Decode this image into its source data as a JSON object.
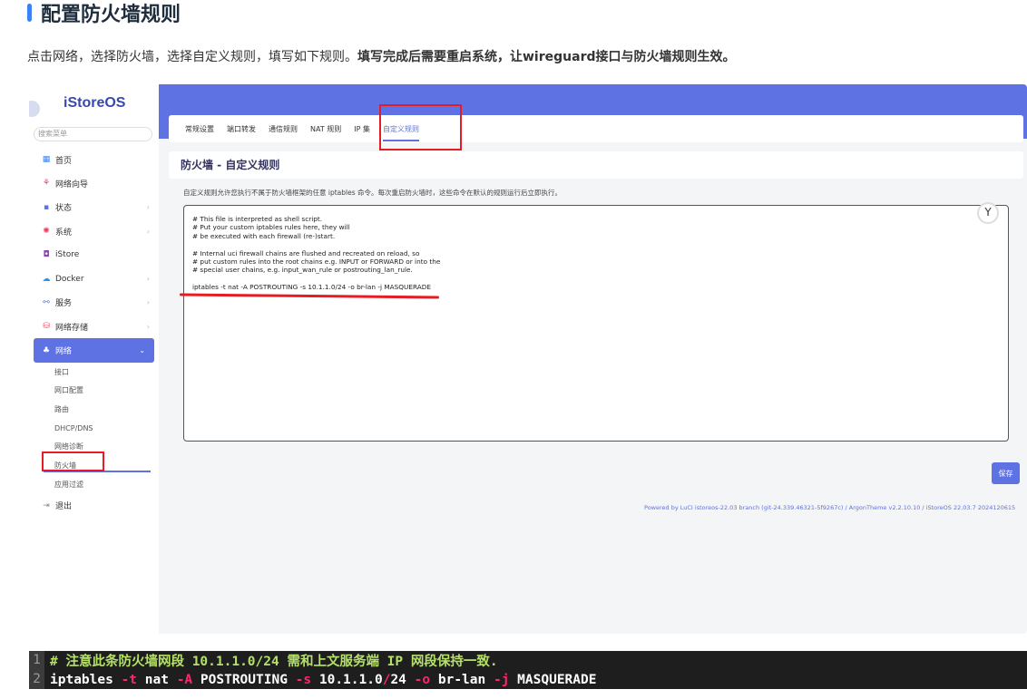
{
  "article": {
    "title": "配置防火墙规则",
    "desc_plain": "点击网络，选择防火墙，选择自定义规则，填写如下规则。",
    "desc_bold": "填写完成后需要重启系统，让wireguard接口与防火墙规则生效。"
  },
  "sidebar": {
    "logo": "iStoreOS",
    "search_placeholder": "搜索菜单",
    "items": [
      {
        "label": "首页",
        "icon": "home-icon",
        "glyph": "▦",
        "color": "#3b82f6"
      },
      {
        "label": "网络向导",
        "icon": "wizard-icon",
        "glyph": "⚘",
        "color": "#f5365c"
      },
      {
        "label": "状态",
        "icon": "status-icon",
        "glyph": "▪",
        "color": "#5e72e4",
        "chevron": "›"
      },
      {
        "label": "系统",
        "icon": "system-icon",
        "glyph": "✺",
        "color": "#f5365c",
        "chevron": "›"
      },
      {
        "label": "iStore",
        "icon": "store-icon",
        "glyph": "◘",
        "color": "#8e44ad"
      },
      {
        "label": "Docker",
        "icon": "docker-icon",
        "glyph": "☁",
        "color": "#2496ed",
        "chevron": "›"
      },
      {
        "label": "服务",
        "icon": "service-icon",
        "glyph": "⚯",
        "color": "#5e72e4",
        "chevron": "›"
      },
      {
        "label": "网络存储",
        "icon": "storage-icon",
        "glyph": "⛁",
        "color": "#f5365c",
        "chevron": "›"
      },
      {
        "label": "网络",
        "icon": "network-icon",
        "glyph": "♣",
        "color": "#ffffff",
        "chevron": "⌄"
      }
    ],
    "sub_items": [
      "接口",
      "网口配置",
      "路由",
      "DHCP/DNS",
      "网络诊断",
      "防火墙",
      "应用过滤"
    ],
    "logout": "退出",
    "logout_glyph": "⇥"
  },
  "tabs": [
    "常规设置",
    "端口转发",
    "通信规则",
    "NAT 规则",
    "IP 集",
    "自定义规则"
  ],
  "card": {
    "title": "防火墙 - 自定义规则",
    "desc": "自定义规则允许您执行不属于防火墙框架的任意 iptables 命令。每次重启防火墙时，这些命令在默认的规则运行后立即执行。"
  },
  "editor_lines": [
    "# This file is interpreted as shell script.",
    "# Put your custom iptables rules here, they will",
    "# be executed with each firewall (re-)start.",
    "",
    "# Internal uci firewall chains are flushed and recreated on reload, so",
    "# put custom rules into the root chains e.g. INPUT or FORWARD or into the",
    "# special user chains, e.g. input_wan_rule or postrouting_lan_rule.",
    "",
    "iptables -t nat -A POSTROUTING -s 10.1.1.0/24 -o br-lan -j MASQUERADE"
  ],
  "save_label": "保存",
  "footer": "Powered by LuCI istoreos-22.03 branch (git-24.339.46321-5f9267c) / ArgonTheme v2.2.10.10 / iStoreOS 22.03.7 2024120615",
  "code": {
    "line1_num": "1",
    "line1": "# 注意此条防火墙网段 10.1.1.0/24 需和上文服务端 IP 网段保持一致.",
    "line2_num": "2",
    "line2_parts": [
      "iptables ",
      "-t",
      " nat ",
      "-A",
      " POSTROUTING ",
      "-s",
      " 10.1.1.0",
      "/",
      "24 ",
      "-o",
      " br-lan ",
      "-j",
      " MASQUERADE"
    ]
  },
  "colors": {
    "accent": "#5e72e4",
    "highlight": "#e51c23"
  }
}
